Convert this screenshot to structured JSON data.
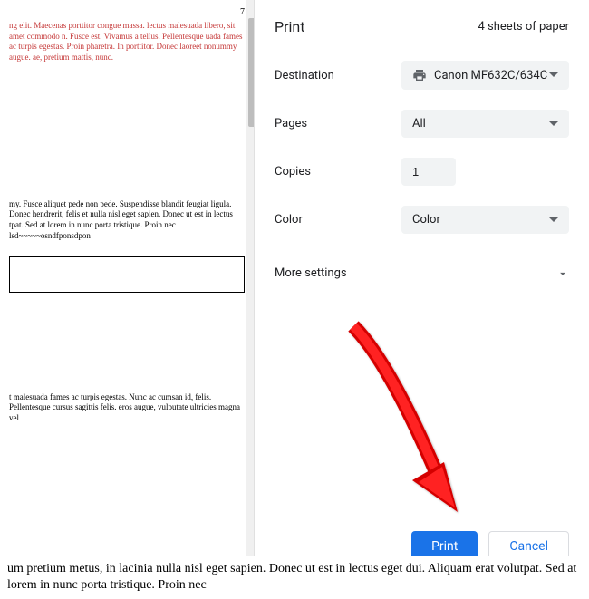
{
  "preview": {
    "page_number": "7",
    "red_text": "ng elit. Maecenas porttitor congue massa. lectus malesuada libero, sit amet commodo n. Fusce est. Vivamus a tellus. Pellentesque uada fames ac turpis egestas. Proin pharetra. In porttitor. Donec laoreet nonummy augue. ae, pretium mattis, nunc.",
    "body_text": "my. Fusce aliquet pede non pede. Suspendisse blandit feugiat ligula. Donec hendrerit, felis et nulla nisl eget sapien. Donec ut est in lectus tpat. Sed at lorem in nunc porta tristique. Proin nec lsd~~~~~osndfponsdpon",
    "lower_text": "t malesuada fames ac turpis egestas. Nunc ac cumsan id, felis. Pellentesque cursus sagittis felis. eros augue, vulputate ultricies magna vel"
  },
  "dialog": {
    "title": "Print",
    "sheets": "4 sheets of paper",
    "destination_label": "Destination",
    "destination_value": "Canon MF632C/634C",
    "pages_label": "Pages",
    "pages_value": "All",
    "copies_label": "Copies",
    "copies_value": "1",
    "color_label": "Color",
    "color_value": "Color",
    "more_settings": "More settings",
    "print_button": "Print",
    "cancel_button": "Cancel"
  },
  "bottom_page_text": "um pretium metus, in lacinia nulla nisl eget sapien. Donec ut est in lectus\neget dui. Aliquam erat volutpat. Sed at lorem in nunc porta tristique. Proin nec"
}
